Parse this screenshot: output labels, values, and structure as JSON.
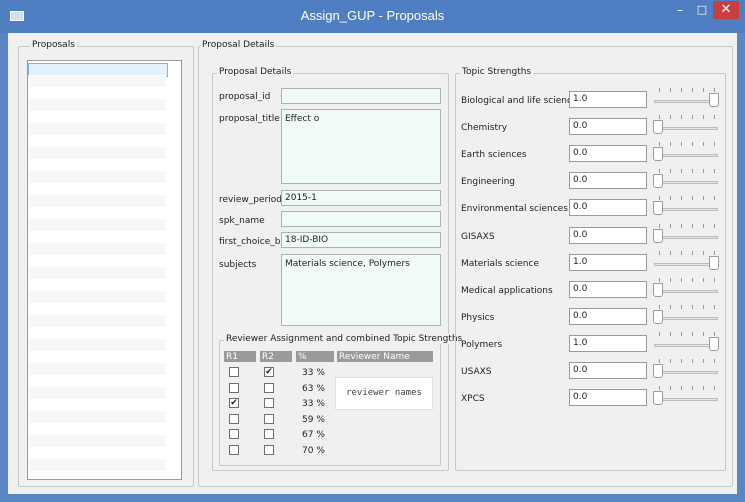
{
  "window": {
    "title": "Assign_GUP - Proposals"
  },
  "proposals_panel": {
    "title": "Proposals"
  },
  "details_panel": {
    "title": "Proposal Details",
    "group_title": "Proposal Details",
    "fields": {
      "proposal_id": {
        "label": "proposal_id",
        "value": ""
      },
      "proposal_title": {
        "label": "proposal_title",
        "value": "Effect o"
      },
      "review_period": {
        "label": "review_period",
        "value": "2015-1"
      },
      "spk_name": {
        "label": "spk_name",
        "value": ""
      },
      "first_choice_bl": {
        "label": "first_choice_bl",
        "value": "18-ID-BIO"
      },
      "subjects": {
        "label": "subjects",
        "value": "Materials science, Polymers"
      }
    }
  },
  "reviewer_group": {
    "title": "Reviewer Assignment and combined Topic Strengths",
    "headers": {
      "r1": "R1",
      "r2": "R2",
      "pct": "%",
      "name": "Reviewer Name"
    },
    "rows": [
      {
        "r1": false,
        "r2": true,
        "pct": "33 %"
      },
      {
        "r1": false,
        "r2": false,
        "pct": "63 %"
      },
      {
        "r1": true,
        "r2": false,
        "pct": "33 %"
      },
      {
        "r1": false,
        "r2": false,
        "pct": "59 %"
      },
      {
        "r1": false,
        "r2": false,
        "pct": "67 %"
      },
      {
        "r1": false,
        "r2": false,
        "pct": "70 %"
      }
    ],
    "check_glyph": "✔",
    "reviewer_names_placeholder": "reviewer names"
  },
  "topic_strengths": {
    "title": "Topic Strengths",
    "topics": [
      {
        "label": "Biological and life sciences",
        "value": "1.0",
        "level": 1.0
      },
      {
        "label": "Chemistry",
        "value": "0.0",
        "level": 0.0
      },
      {
        "label": "Earth sciences",
        "value": "0.0",
        "level": 0.0
      },
      {
        "label": "Engineering",
        "value": "0.0",
        "level": 0.0
      },
      {
        "label": "Environmental sciences",
        "value": "0.0",
        "level": 0.0
      },
      {
        "label": "GISAXS",
        "value": "0.0",
        "level": 0.0
      },
      {
        "label": "Materials science",
        "value": "1.0",
        "level": 1.0
      },
      {
        "label": "Medical applications",
        "value": "0.0",
        "level": 0.0
      },
      {
        "label": "Physics",
        "value": "0.0",
        "level": 0.0
      },
      {
        "label": "Polymers",
        "value": "1.0",
        "level": 1.0
      },
      {
        "label": "USAXS",
        "value": "0.0",
        "level": 0.0
      },
      {
        "label": "XPCS",
        "value": "0.0",
        "level": 0.0
      }
    ]
  },
  "colors": {
    "titlebar": "#4f7fc2",
    "close": "#c7403d",
    "field_bg": "#f0fbf8",
    "list_selected": "#e2f1fb"
  },
  "icons": {
    "minimize": "minimize-icon",
    "maximize": "maximize-icon",
    "close": "close-icon",
    "scroll_up": "chevron-up-icon",
    "scroll_down": "chevron-down-icon"
  },
  "glyphs": {
    "minimize": "–",
    "maximize": "□",
    "close": "✕",
    "scroll_up": "⌃",
    "scroll_down": "⌄"
  }
}
